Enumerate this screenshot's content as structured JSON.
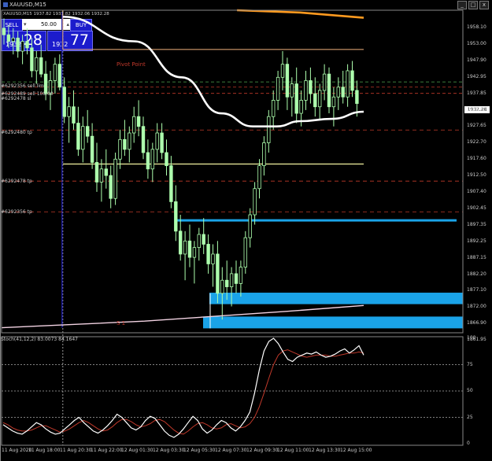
{
  "title": "XAUUSD,M15",
  "window_controls": [
    "_",
    "□",
    "x"
  ],
  "trade_panel": {
    "sell_label": "SELL",
    "buy_label": "BUY",
    "lot": "50.00",
    "bid_small": "1932",
    "bid_big": "28",
    "ask_small": "1932",
    "ask_big": "77"
  },
  "header_info": "XAUUSD,M15  1937.82 1937.82 1932.06 1932.28",
  "order_labels": [
    "#6292356 sell lim",
    "#6292489 sell 100.00",
    "#6292478 sl",
    "#6292480 tp",
    "#6292478 tp",
    "#6292356 tp"
  ],
  "pivot_label": "Pivot Point",
  "s1_label": "S 1",
  "current_price": "1932.28",
  "price_axis": [
    "1958.10",
    "1953.00",
    "1947.90",
    "1942.95",
    "1937.85",
    "1932.80",
    "1927.65",
    "1922.70",
    "1917.60",
    "1912.50",
    "1907.40",
    "1902.45",
    "1897.35",
    "1892.25",
    "1887.15",
    "1882.20",
    "1877.10",
    "1872.00",
    "1866.90",
    "1861.95"
  ],
  "stoch_label": "Stoch(41,12,2) 83.0073 84.1647",
  "stoch_axis": [
    "100",
    "75",
    "50",
    "25",
    "0"
  ],
  "time_axis": [
    "11 Aug 2020",
    "11 Aug 18:00",
    "11 Aug 20:30",
    "11 Aug 22:00",
    "12 Aug 01:30",
    "12 Aug 03:30",
    "12 Aug 05:30",
    "12 Aug 07:30",
    "12 Aug 09:30",
    "12 Aug 11:00",
    "12 Aug 13:30",
    "12 Aug 15:00"
  ],
  "colors": {
    "bull_candle": "#adffad",
    "pivot": "#f2b27e",
    "resistance": "#f2f2a0",
    "blue_zone": "#1aa3e8",
    "ma_white": "#ffffff",
    "ma_orange": "#ff9a1f",
    "order_line": "#c0392b",
    "stoch_main": "#ffffff",
    "stoch_signal": "#c0392b"
  },
  "chart_data": {
    "type": "candlestick",
    "ylim": [
      1861.95,
      1960.5
    ],
    "candles": [
      [
        1955,
        1958,
        1950,
        1953
      ],
      [
        1953,
        1956,
        1949,
        1951
      ],
      [
        1951,
        1955,
        1947,
        1952
      ],
      [
        1952,
        1954,
        1946,
        1948
      ],
      [
        1948,
        1953,
        1944,
        1951
      ],
      [
        1951,
        1955,
        1947,
        1949
      ],
      [
        1949,
        1952,
        1940,
        1942
      ],
      [
        1942,
        1948,
        1938,
        1946
      ],
      [
        1946,
        1950,
        1940,
        1941
      ],
      [
        1941,
        1945,
        1933,
        1935
      ],
      [
        1935,
        1942,
        1930,
        1939
      ],
      [
        1939,
        1946,
        1935,
        1944
      ],
      [
        1944,
        1947,
        1936,
        1937
      ],
      [
        1937,
        1940,
        1926,
        1928
      ],
      [
        1928,
        1934,
        1920,
        1931
      ],
      [
        1931,
        1936,
        1924,
        1926
      ],
      [
        1926,
        1931,
        1916,
        1918
      ],
      [
        1918,
        1928,
        1914,
        1925
      ],
      [
        1925,
        1930,
        1920,
        1922
      ],
      [
        1922,
        1926,
        1912,
        1914
      ],
      [
        1914,
        1920,
        1905,
        1908
      ],
      [
        1908,
        1915,
        1902,
        1912
      ],
      [
        1912,
        1918,
        1906,
        1910
      ],
      [
        1910,
        1913,
        1900,
        1903
      ],
      [
        1903,
        1917,
        1901,
        1915
      ],
      [
        1915,
        1924,
        1912,
        1921
      ],
      [
        1921,
        1927,
        1916,
        1918
      ],
      [
        1918,
        1925,
        1914,
        1923
      ],
      [
        1923,
        1931,
        1920,
        1928
      ],
      [
        1928,
        1933,
        1922,
        1925
      ],
      [
        1925,
        1928,
        1915,
        1917
      ],
      [
        1917,
        1921,
        1909,
        1912
      ],
      [
        1912,
        1920,
        1908,
        1918
      ],
      [
        1918,
        1926,
        1914,
        1923
      ],
      [
        1923,
        1926,
        1915,
        1917
      ],
      [
        1917,
        1921,
        1910,
        1913
      ],
      [
        1913,
        1916,
        1900,
        1902
      ],
      [
        1902,
        1907,
        1890,
        1893
      ],
      [
        1893,
        1898,
        1884,
        1886
      ],
      [
        1886,
        1893,
        1878,
        1890
      ],
      [
        1890,
        1895,
        1882,
        1885
      ],
      [
        1885,
        1890,
        1877,
        1888
      ],
      [
        1888,
        1894,
        1884,
        1892
      ],
      [
        1892,
        1897,
        1886,
        1889
      ],
      [
        1889,
        1892,
        1880,
        1883
      ],
      [
        1883,
        1889,
        1876,
        1886
      ],
      [
        1886,
        1890,
        1871,
        1874
      ],
      [
        1874,
        1882,
        1866,
        1878
      ],
      [
        1878,
        1884,
        1872,
        1876
      ],
      [
        1876,
        1882,
        1870,
        1880
      ],
      [
        1880,
        1884,
        1874,
        1877
      ],
      [
        1877,
        1884,
        1873,
        1882
      ],
      [
        1882,
        1893,
        1880,
        1891
      ],
      [
        1891,
        1900,
        1888,
        1898
      ],
      [
        1898,
        1908,
        1895,
        1906
      ],
      [
        1906,
        1915,
        1903,
        1913
      ],
      [
        1913,
        1922,
        1910,
        1920
      ],
      [
        1920,
        1930,
        1917,
        1928
      ],
      [
        1928,
        1936,
        1924,
        1933
      ],
      [
        1933,
        1942,
        1930,
        1940
      ],
      [
        1940,
        1948,
        1936,
        1944
      ],
      [
        1944,
        1946,
        1930,
        1934
      ],
      [
        1934,
        1940,
        1928,
        1938
      ],
      [
        1938,
        1943,
        1926,
        1929
      ],
      [
        1929,
        1936,
        1925,
        1933
      ],
      [
        1933,
        1942,
        1930,
        1939
      ],
      [
        1939,
        1943,
        1932,
        1935
      ],
      [
        1935,
        1940,
        1928,
        1931
      ],
      [
        1931,
        1938,
        1927,
        1936
      ],
      [
        1936,
        1944,
        1933,
        1941
      ],
      [
        1941,
        1943,
        1929,
        1931
      ],
      [
        1931,
        1937,
        1925,
        1934
      ],
      [
        1934,
        1940,
        1930,
        1937
      ],
      [
        1937,
        1942,
        1932,
        1934
      ],
      [
        1934,
        1944,
        1931,
        1942
      ],
      [
        1942,
        1945,
        1934,
        1936
      ],
      [
        1936,
        1939,
        1928,
        1932
      ]
    ],
    "white_ma": [
      [
        0,
        1958.5
      ],
      [
        18,
        1951
      ],
      [
        30,
        1940
      ],
      [
        40,
        1929
      ],
      [
        48,
        1925
      ],
      [
        54,
        1925
      ],
      [
        60,
        1926.6
      ],
      [
        68,
        1927.3
      ],
      [
        76,
        1929.5
      ]
    ],
    "orange_ma": [
      [
        44,
        1960.5
      ],
      [
        60,
        1959.8
      ],
      [
        76,
        1958.2
      ]
    ],
    "lower_ma": [
      [
        0,
        1863.5
      ],
      [
        30,
        1865.5
      ],
      [
        60,
        1868.5
      ],
      [
        76,
        1870.3
      ]
    ],
    "levels": {
      "pivot": 1948.5,
      "resistance": 1913.5,
      "blue_line": 1896.3,
      "blue_zone_top": [
        1874.2,
        1870.7
      ],
      "blue_zone_bottom": [
        1866.9,
        1863.3
      ]
    },
    "order_levels": [
      1938.6,
      1937.0,
      1935.1,
      1923.9,
      1908.3,
      1898.9
    ],
    "vertical_line_x": 12,
    "stoch_main": [
      18,
      15,
      12,
      10,
      9,
      12,
      16,
      20,
      18,
      14,
      11,
      9,
      10,
      14,
      18,
      22,
      25,
      20,
      16,
      12,
      10,
      13,
      17,
      22,
      28,
      25,
      20,
      15,
      13,
      16,
      22,
      26,
      24,
      18,
      12,
      8,
      6,
      9,
      14,
      20,
      26,
      22,
      14,
      10,
      13,
      18,
      22,
      20,
      15,
      12,
      16,
      22,
      30,
      48,
      70,
      88,
      97,
      100,
      95,
      87,
      80,
      78,
      82,
      84,
      86,
      85,
      87,
      84,
      82,
      83,
      85,
      88,
      90,
      86,
      89,
      93,
      84
    ],
    "stoch_signal": [
      20,
      18,
      15,
      13,
      12,
      12,
      13,
      15,
      17,
      17,
      15,
      13,
      11,
      12,
      14,
      17,
      20,
      22,
      20,
      17,
      14,
      12,
      13,
      16,
      20,
      23,
      23,
      21,
      18,
      16,
      17,
      19,
      22,
      23,
      21,
      17,
      13,
      10,
      9,
      12,
      16,
      19,
      20,
      18,
      15,
      14,
      15,
      18,
      19,
      17,
      15,
      16,
      19,
      25,
      35,
      48,
      62,
      75,
      84,
      88,
      89,
      87,
      85,
      83,
      82,
      83,
      84,
      84,
      84,
      83,
      83,
      84,
      85,
      86,
      86,
      87,
      86
    ],
    "stoch_ylim": [
      0,
      100
    ],
    "stoch_levels": [
      75,
      50,
      25
    ]
  }
}
